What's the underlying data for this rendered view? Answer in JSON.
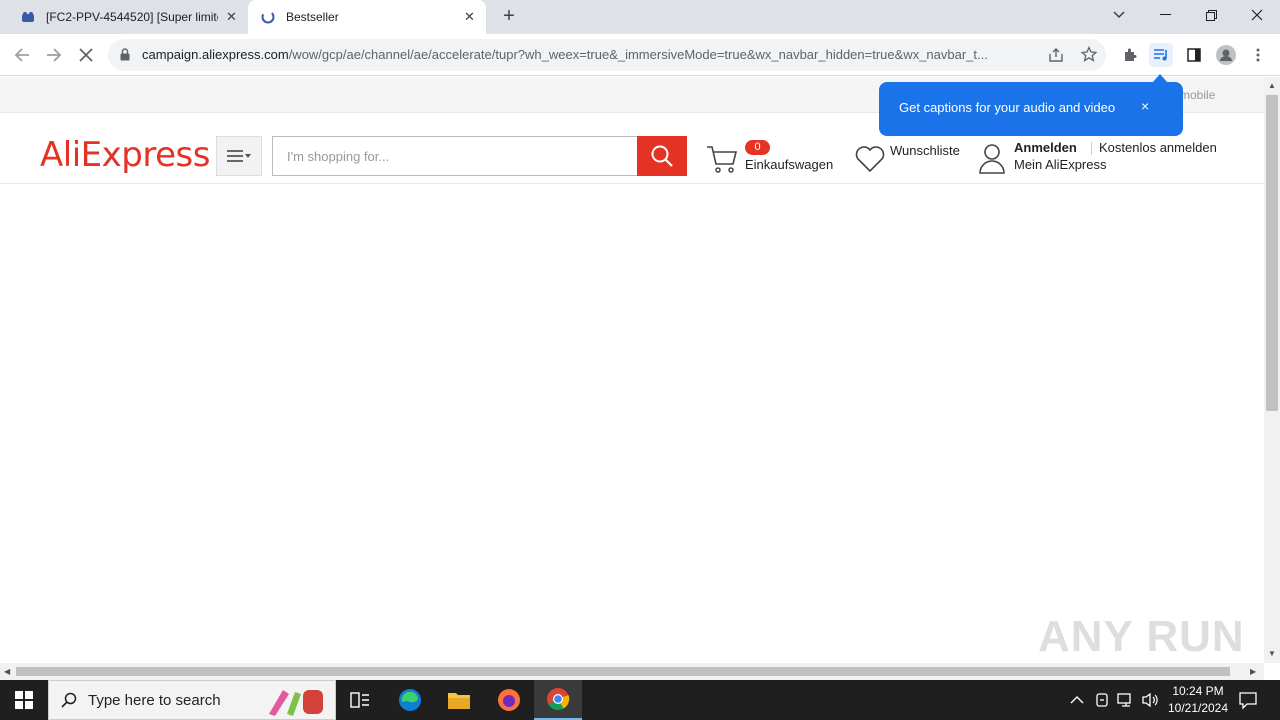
{
  "browser": {
    "tabs": [
      {
        "title": "[FC2-PPV-4544520] [Super limited",
        "active": false
      },
      {
        "title": "Bestseller",
        "active": true
      }
    ],
    "new_tab_label": "+",
    "url_host": "campaign.aliexpress.com",
    "url_path": "/wow/gcp/ae/channel/ae/accelerate/tupr?wh_weex=true&_immersiveMode=true&wx_navbar_hidden=true&wx_navbar_t..."
  },
  "caption_bubble": {
    "text": "Get captions for your audio and video",
    "close": "×"
  },
  "page": {
    "topbar_mobile": "mobile",
    "logo": "AliExpress",
    "search_placeholder": "I'm shopping for...",
    "cart": {
      "count": "0",
      "label": "Einkaufswagen"
    },
    "wishlist_label": "Wunschliste",
    "account": {
      "signin": "Anmelden",
      "register": "Kostenlos anmelden",
      "my_account": "Mein AliExpress"
    }
  },
  "watermark": "ANY RUN",
  "taskbar": {
    "search_text": "Type here to search",
    "time": "10:24 PM",
    "date": "10/21/2024"
  },
  "colors": {
    "brand": "#e43225",
    "bubble": "#1a73e8"
  }
}
